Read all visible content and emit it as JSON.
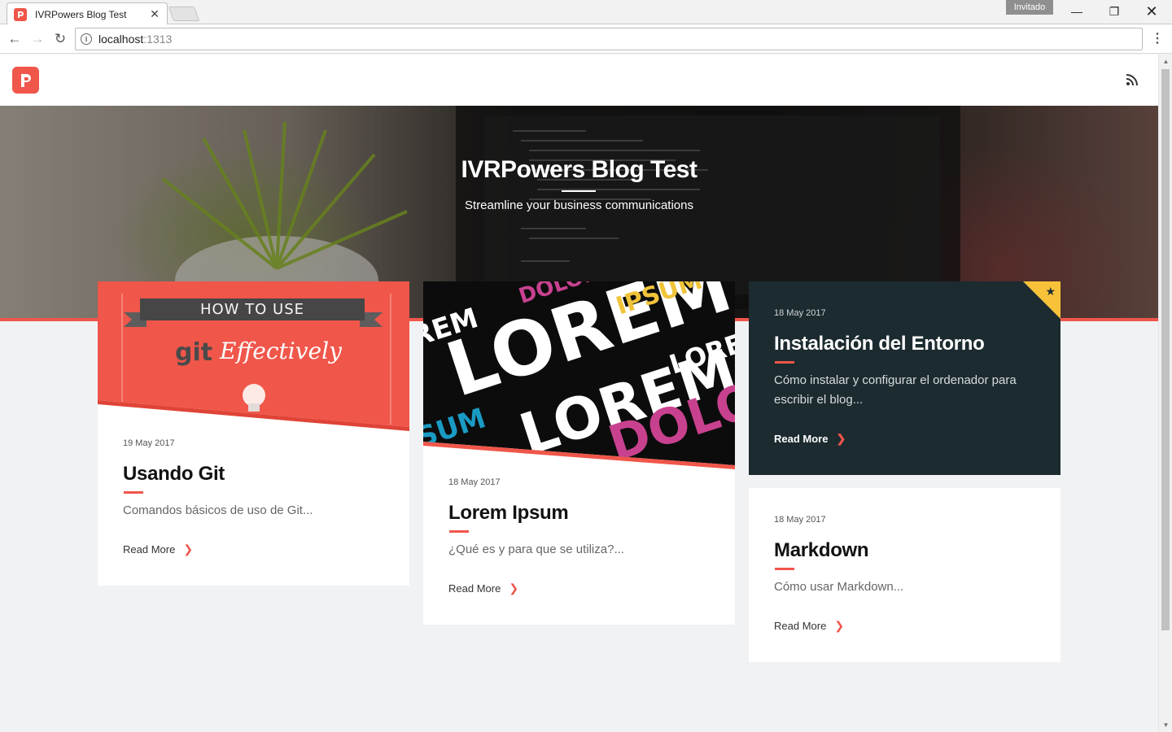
{
  "browser": {
    "tab_title": "IVRPowers Blog Test",
    "tab_close": "✕",
    "guest_label": "Invitado",
    "url_host": "localhost",
    "url_port": ":1313",
    "min_glyph": "—",
    "max_glyph": "❐",
    "close_glyph": "✕",
    "back_glyph": "←",
    "forward_glyph": "→",
    "reload_glyph": "↻",
    "menu_glyph": "⋮",
    "info_glyph": "i"
  },
  "header": {
    "logo_icon": "ivrpowers-logo-icon",
    "rss_icon": "rss-icon"
  },
  "hero": {
    "title": "IVRPowers Blog Test",
    "subtitle": "Streamline your business communications"
  },
  "posts": [
    {
      "date": "19 May 2017",
      "title": "Usando Git",
      "excerpt": "Comandos básicos de uso de Git...",
      "read_more": "Read More",
      "image_text_top": "HOW TO USE",
      "image_text_main": "git",
      "image_text_script": "Effectively"
    },
    {
      "date": "18 May 2017",
      "title": "Lorem Ipsum",
      "excerpt": "¿Qué es y para que se utiliza?...",
      "read_more": "Read More",
      "image_words": [
        "LOREM",
        "IPSUM",
        "DOLOR"
      ]
    },
    {
      "date": "18 May 2017",
      "title": "Instalación del Entorno",
      "excerpt": "Cómo instalar y configurar el ordenador para escribir el blog...",
      "read_more": "Read More",
      "featured": true
    },
    {
      "date": "18 May 2017",
      "title": "Markdown",
      "excerpt": "Cómo usar Markdown...",
      "read_more": "Read More"
    }
  ],
  "colors": {
    "accent": "#f0564a",
    "featured_bg": "#1c2b30",
    "star": "#f7c23a"
  }
}
